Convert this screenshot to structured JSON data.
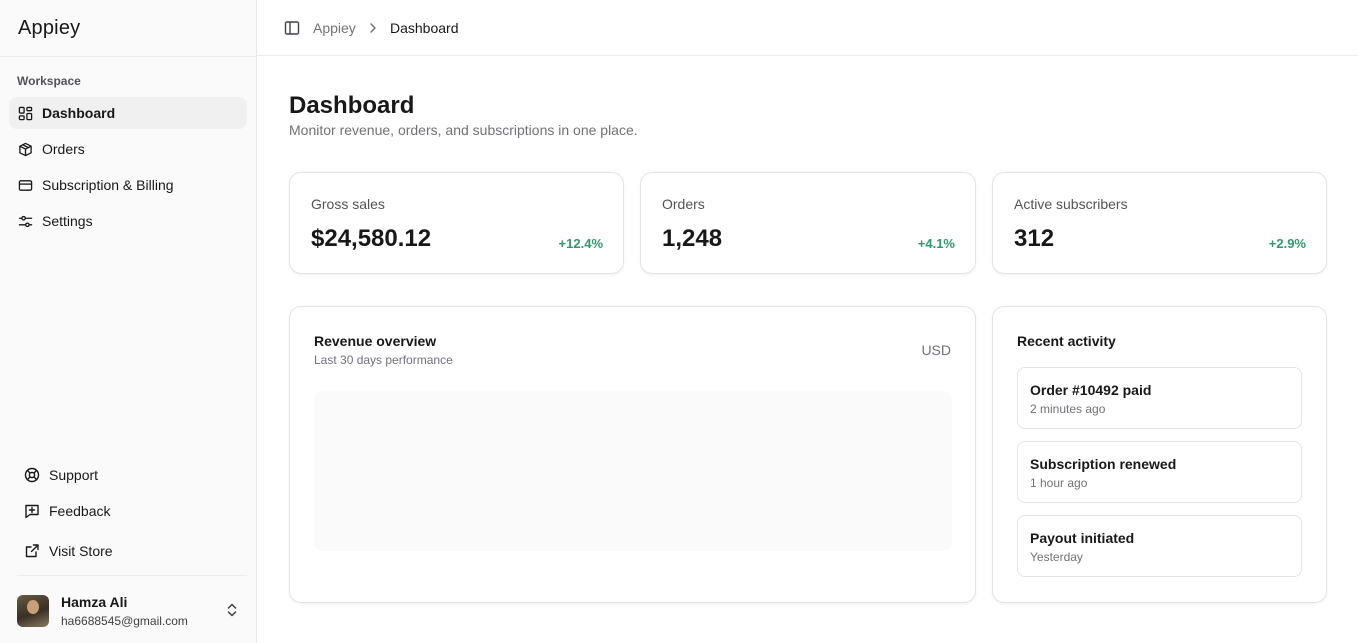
{
  "app": {
    "name": "Appiey"
  },
  "sidebar": {
    "section_label": "Workspace",
    "items": [
      {
        "label": "Dashboard",
        "icon": "dashboard-icon",
        "active": true
      },
      {
        "label": "Orders",
        "icon": "box-icon",
        "active": false
      },
      {
        "label": "Subscription & Billing",
        "icon": "credit-card-icon",
        "active": false
      },
      {
        "label": "Settings",
        "icon": "sliders-icon",
        "active": false
      }
    ],
    "footer": [
      {
        "label": "Support",
        "icon": "life-buoy-icon"
      },
      {
        "label": "Feedback",
        "icon": "message-plus-icon"
      },
      {
        "label": "Visit Store",
        "icon": "external-link-icon"
      }
    ],
    "user": {
      "name": "Hamza Ali",
      "email": "ha6688545@gmail.com"
    }
  },
  "header": {
    "breadcrumb": [
      "Appiey",
      "Dashboard"
    ]
  },
  "main": {
    "title": "Dashboard",
    "subtitle": "Monitor revenue, orders, and subscriptions in one place.",
    "stats": [
      {
        "label": "Gross sales",
        "value": "$24,580.12",
        "delta": "+12.4%"
      },
      {
        "label": "Orders",
        "value": "1,248",
        "delta": "+4.1%"
      },
      {
        "label": "Active subscribers",
        "value": "312",
        "delta": "+2.9%"
      }
    ],
    "revenue": {
      "title": "Revenue overview",
      "subtitle": "Last 30 days performance",
      "unit": "USD"
    },
    "activity": {
      "title": "Recent activity",
      "items": [
        {
          "title": "Order #10492 paid",
          "time": "2 minutes ago"
        },
        {
          "title": "Subscription renewed",
          "time": "1 hour ago"
        },
        {
          "title": "Payout initiated",
          "time": "Yesterday"
        }
      ]
    }
  },
  "colors": {
    "positive": "#2f9a6a",
    "active_bg": "#f0f0f1",
    "border": "#e4e4e7"
  }
}
